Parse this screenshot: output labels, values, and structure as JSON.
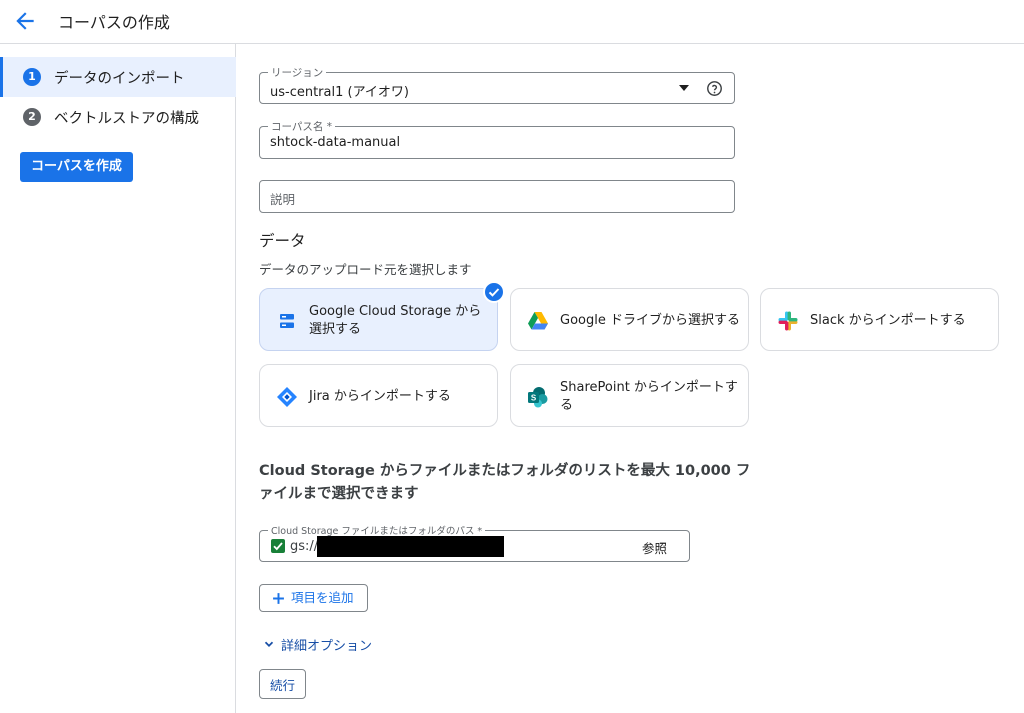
{
  "header": {
    "title": "コーパスの作成",
    "back_icon": "arrow-left-icon"
  },
  "sidebar": {
    "steps": [
      {
        "number": "1",
        "label": "データのインポート",
        "active": true
      },
      {
        "number": "2",
        "label": "ベクトルストアの構成",
        "active": false
      }
    ],
    "create_button": "コーパスを作成"
  },
  "form": {
    "region": {
      "label": "リージョン",
      "value": "us-central1 (アイオワ)"
    },
    "corpus_name": {
      "label": "コーパス名 *",
      "value": "shtock-data-manual"
    },
    "description": {
      "placeholder": "説明"
    }
  },
  "data_section": {
    "title": "データ",
    "subtitle": "データのアップロード元を選択します",
    "sources": [
      {
        "label": "Google Cloud Storage から選択する",
        "icon": "cloud-storage-icon",
        "selected": true
      },
      {
        "label": "Google ドライブから選択する",
        "icon": "google-drive-icon",
        "selected": false
      },
      {
        "label": "Slack からインポートする",
        "icon": "slack-icon",
        "selected": false
      },
      {
        "label": "Jira からインポートする",
        "icon": "jira-icon",
        "selected": false
      },
      {
        "label": "SharePoint からインポートする",
        "icon": "sharepoint-icon",
        "selected": false
      }
    ]
  },
  "gcs": {
    "heading_line1": "Cloud Storage からファイルまたはフォルダのリストを最大 10,000 フ",
    "heading_line2": "ァイルまで選択できます",
    "path_label": "Cloud Storage ファイルまたはフォルダのパス *",
    "path_prefix": "gs://",
    "browse": "参照",
    "add_item": "項目を追加",
    "advanced_options": "詳細オプション",
    "continue": "続行"
  },
  "colors": {
    "accent": "#1a73e8",
    "selected_card": "#e8f0fe",
    "check_green": "#188038"
  }
}
